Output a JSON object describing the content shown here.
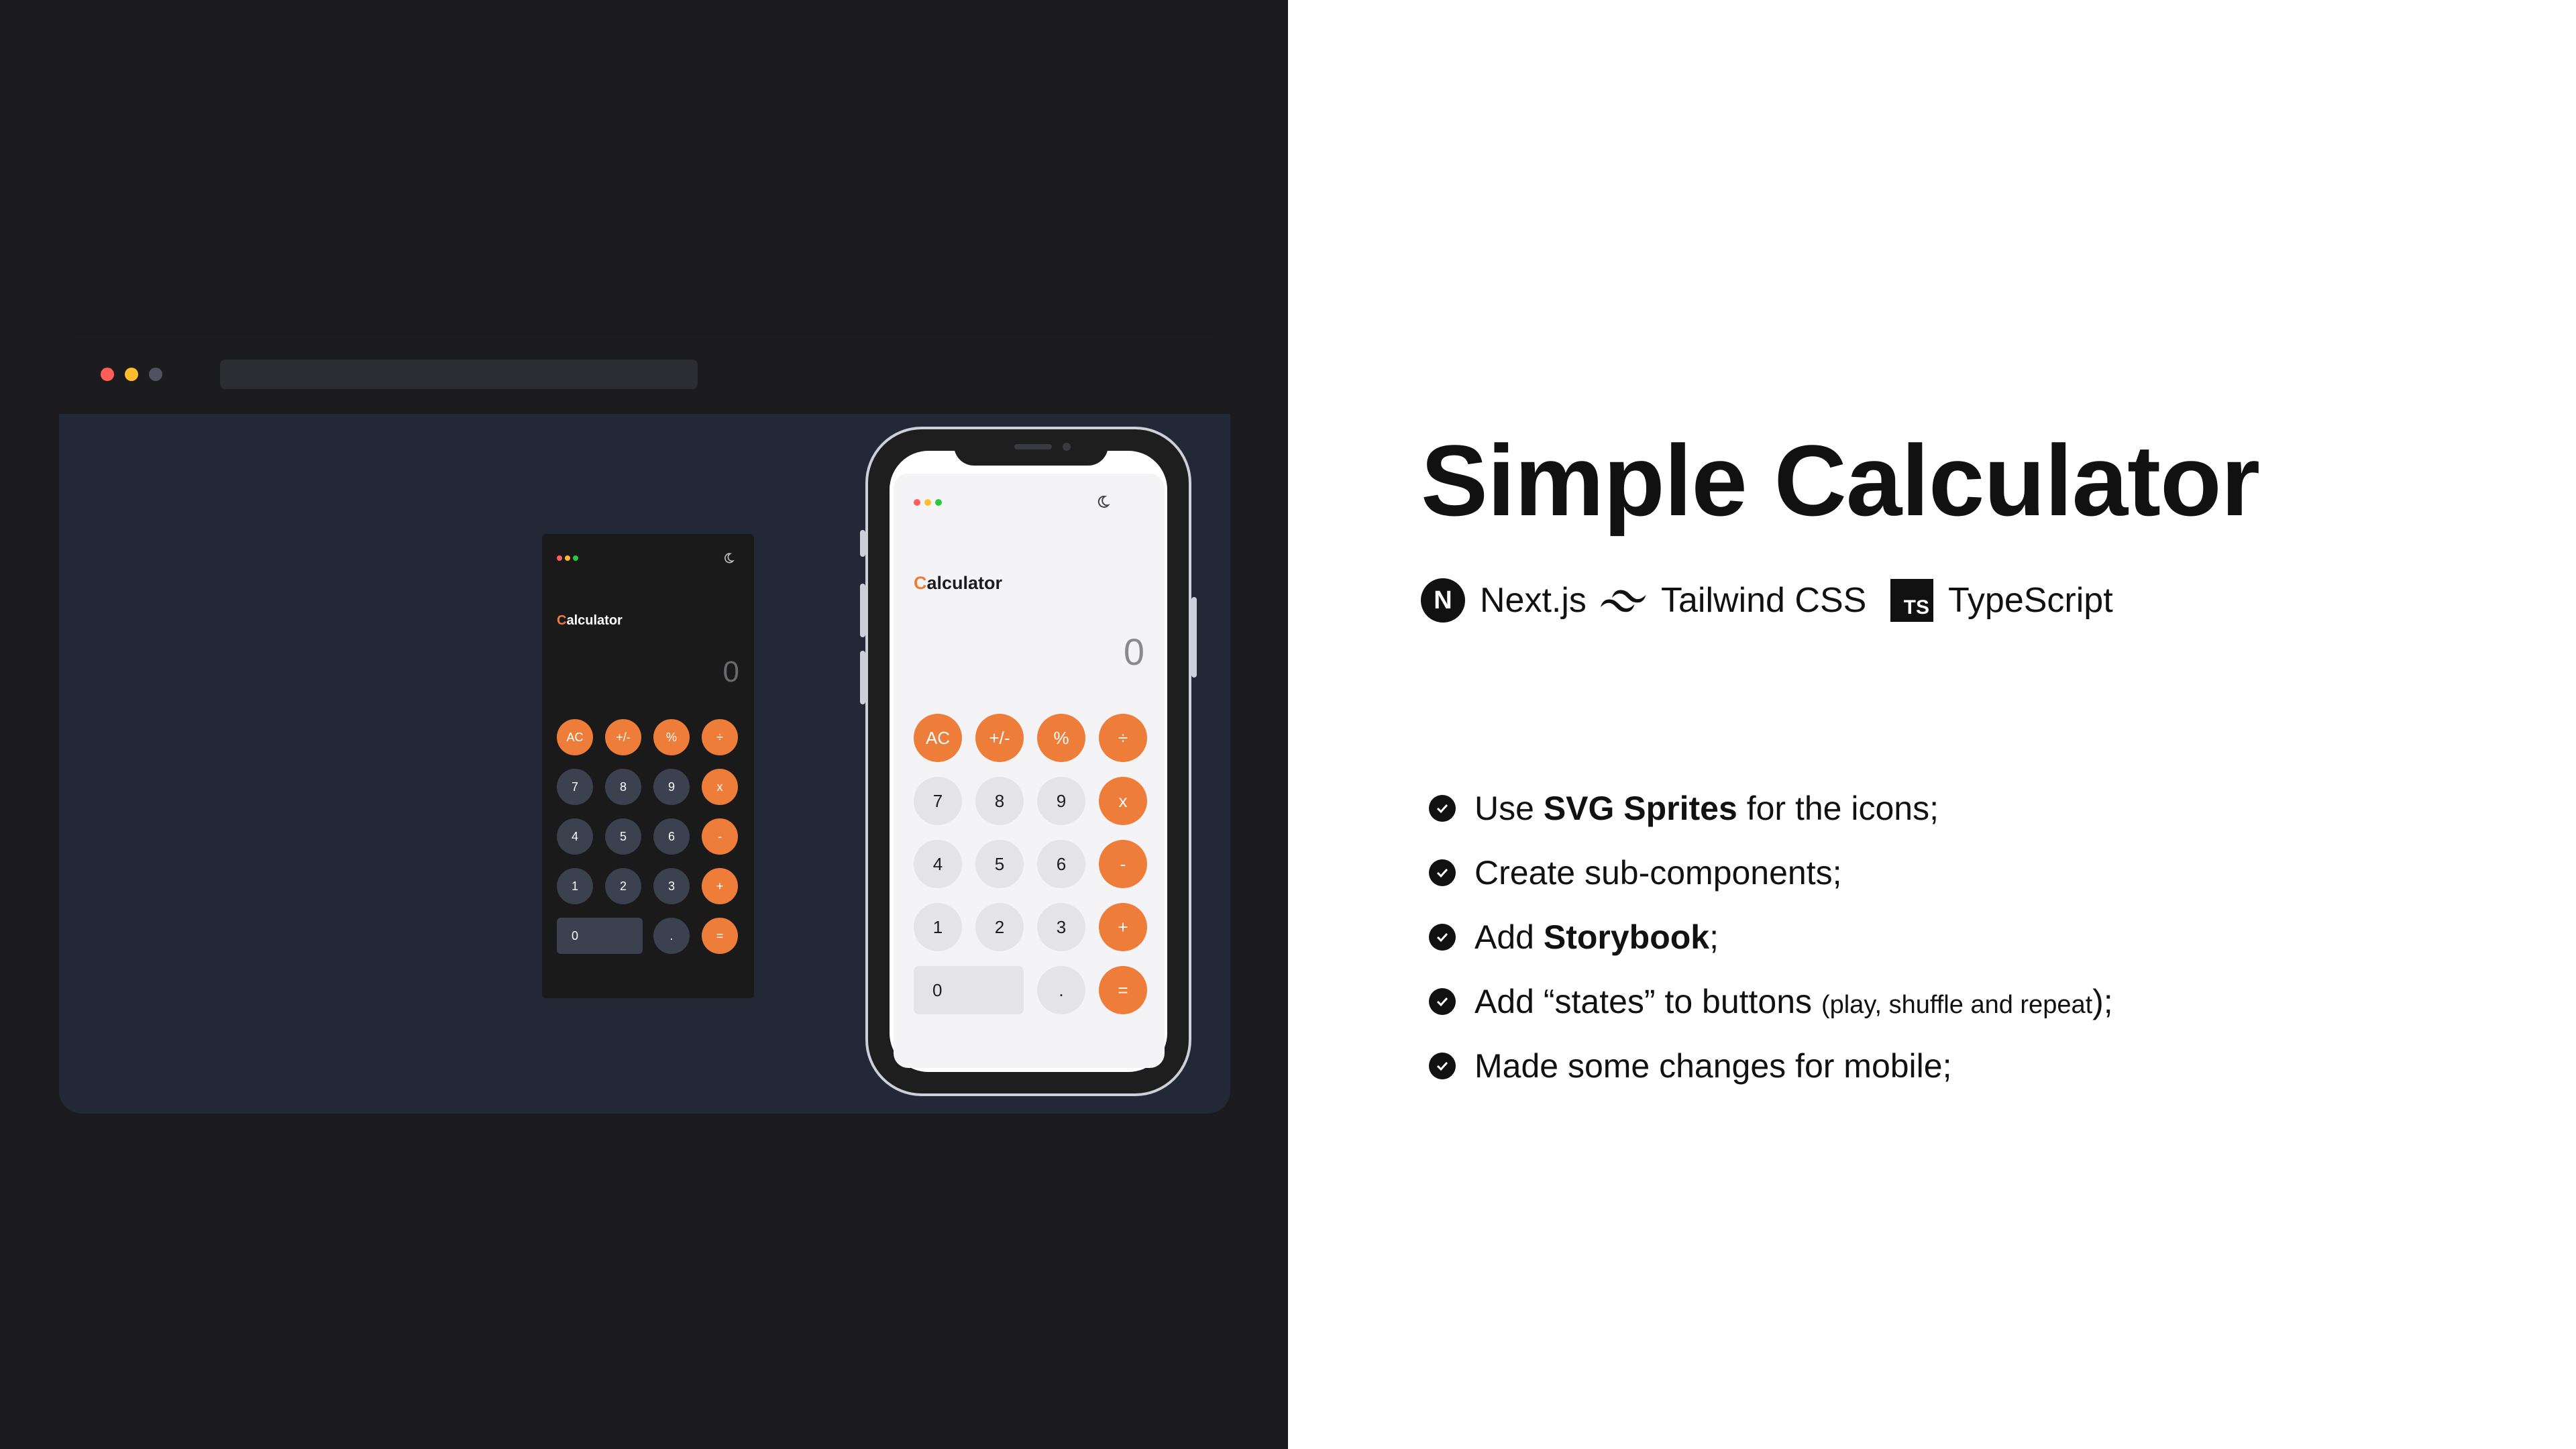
{
  "slide": {
    "title": "Simple Calculator",
    "tech": [
      {
        "label": "Next.js",
        "icon": "nextjs-icon",
        "logo_letter": "N"
      },
      {
        "label": "Tailwind CSS",
        "icon": "tailwind-icon"
      },
      {
        "label": "TypeScript",
        "icon": "typescript-icon",
        "logo_text": "TS"
      }
    ],
    "features": [
      {
        "before": "Use ",
        "bold": "SVG Sprites",
        "after": " for the icons;",
        "small": ""
      },
      {
        "before": "Create sub-components;",
        "bold": "",
        "after": "",
        "small": ""
      },
      {
        "before": "Add ",
        "bold": "Storybook",
        "after": ";",
        "small": ""
      },
      {
        "before": "Add “states” to buttons ",
        "bold": "",
        "after": ");",
        "small": "(play, shuffle and repeat"
      },
      {
        "before": "Made some changes for mobile;",
        "bold": "",
        "after": "",
        "small": ""
      }
    ]
  },
  "calculator": {
    "title_accent": "C",
    "title_rest": "alculator",
    "display": "0",
    "buttons": [
      [
        "AC",
        "+/-",
        "%",
        "÷"
      ],
      [
        "7",
        "8",
        "9",
        "x"
      ],
      [
        "4",
        "5",
        "6",
        "-"
      ],
      [
        "1",
        "2",
        "3",
        "+"
      ],
      [
        "0",
        ".",
        "="
      ]
    ]
  },
  "colors": {
    "accent": "#ef7d3a",
    "dark_bg": "#1b1b1f",
    "browser_body": "#222836",
    "traffic_red": "#ff5f56",
    "traffic_yellow": "#ffbd2e",
    "traffic_green": "#27c93f"
  }
}
